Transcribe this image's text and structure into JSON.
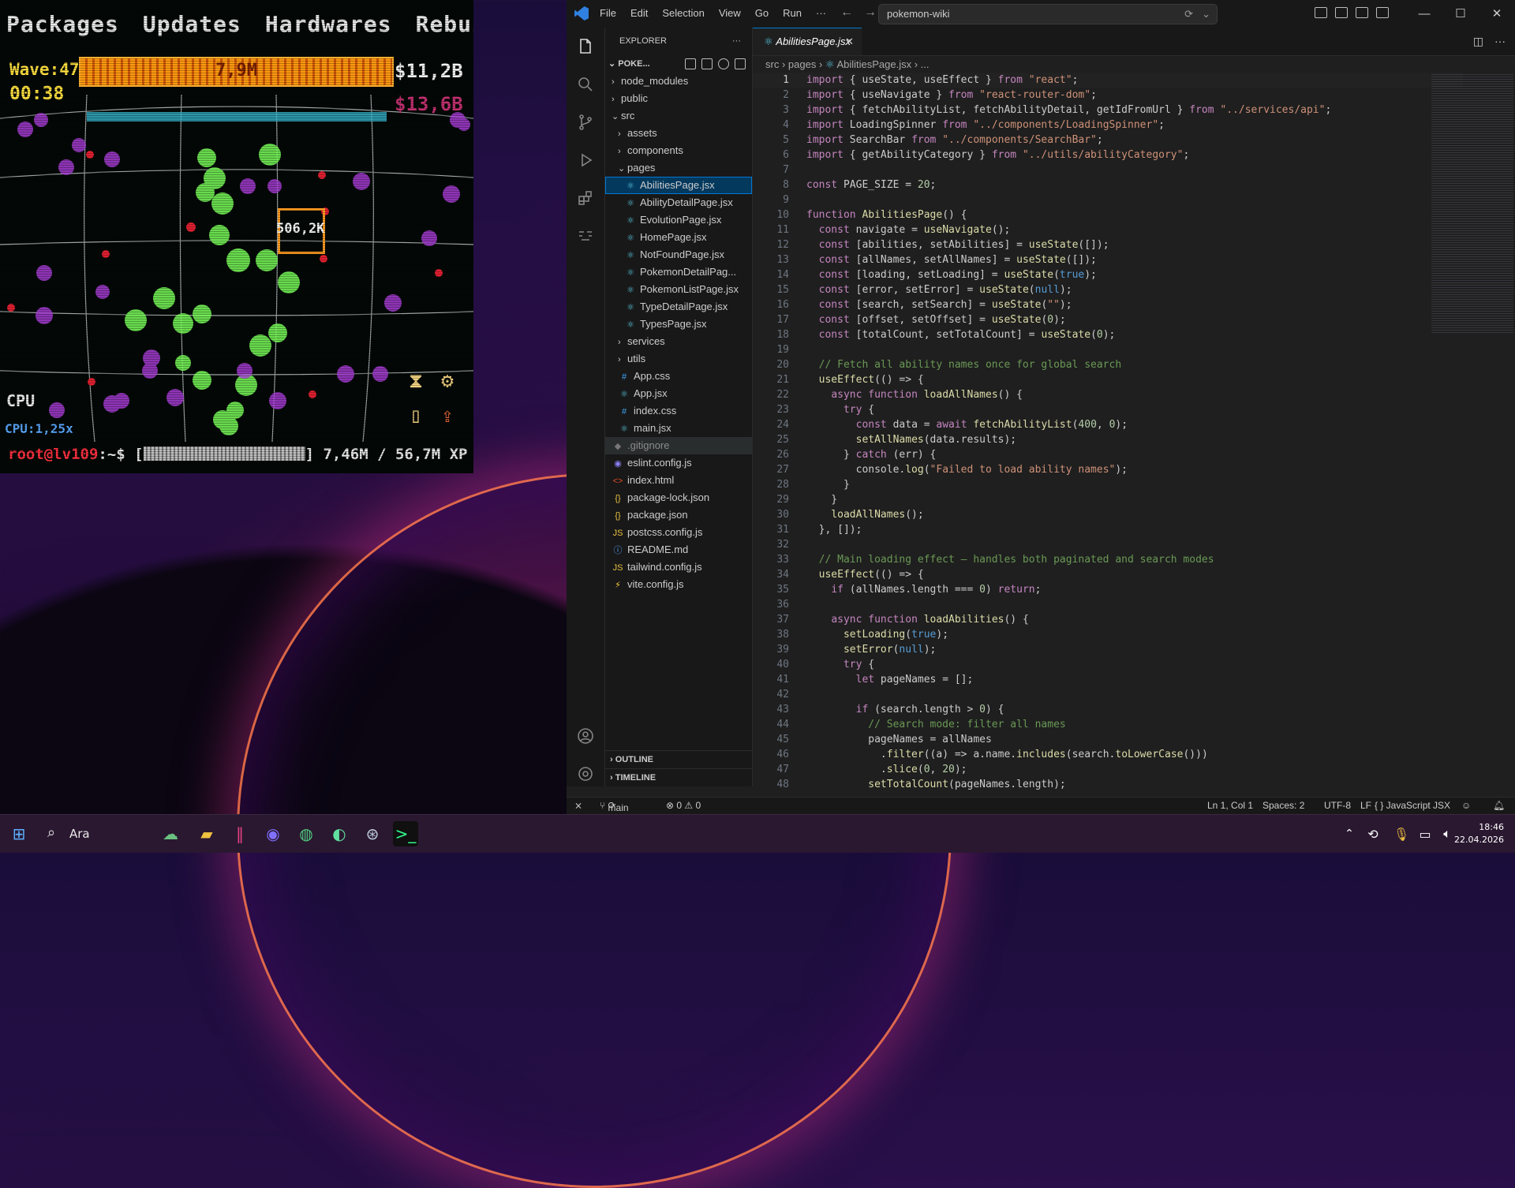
{
  "game": {
    "menu": [
      "Packages",
      "Updates",
      "Hardwares",
      "Rebuild"
    ],
    "wave": "Wave:47",
    "wave_bar_value": "7,9M",
    "timer": "00:38",
    "money_primary": "$11,2B",
    "money_secondary": "$13,6B",
    "target_label": "506,2K",
    "cpu_label": "CPU",
    "cpu_rate": "CPU:1,25x",
    "prompt_user": "root@lv109",
    "prompt_path": ":~$ [",
    "xp_text": "] 7,46M / 56,7M XP"
  },
  "window": {
    "menu": [
      "File",
      "Edit",
      "Selection",
      "View",
      "Go",
      "Run",
      "···"
    ],
    "search_text": "pokemon-wiki",
    "controls": [
      "—",
      "☐",
      "✕"
    ]
  },
  "explorer": {
    "title": "EXPLORER",
    "project": "POKE...",
    "items": [
      {
        "label": "node_modules",
        "indent": 0,
        "type": "folder",
        "open": false
      },
      {
        "label": "public",
        "indent": 0,
        "type": "folder",
        "open": false
      },
      {
        "label": "src",
        "indent": 0,
        "type": "folder",
        "open": true
      },
      {
        "label": "assets",
        "indent": 1,
        "type": "folder",
        "open": false
      },
      {
        "label": "components",
        "indent": 1,
        "type": "folder",
        "open": false
      },
      {
        "label": "pages",
        "indent": 1,
        "type": "folder",
        "open": true
      },
      {
        "label": "AbilitiesPage.jsx",
        "indent": 2,
        "type": "react",
        "selected": true
      },
      {
        "label": "AbilityDetailPage.jsx",
        "indent": 2,
        "type": "react"
      },
      {
        "label": "EvolutionPage.jsx",
        "indent": 2,
        "type": "react"
      },
      {
        "label": "HomePage.jsx",
        "indent": 2,
        "type": "react"
      },
      {
        "label": "NotFoundPage.jsx",
        "indent": 2,
        "type": "react"
      },
      {
        "label": "PokemonDetailPag...",
        "indent": 2,
        "type": "react"
      },
      {
        "label": "PokemonListPage.jsx",
        "indent": 2,
        "type": "react"
      },
      {
        "label": "TypeDetailPage.jsx",
        "indent": 2,
        "type": "react"
      },
      {
        "label": "TypesPage.jsx",
        "indent": 2,
        "type": "react"
      },
      {
        "label": "services",
        "indent": 1,
        "type": "folder",
        "open": false
      },
      {
        "label": "utils",
        "indent": 1,
        "type": "folder",
        "open": false
      },
      {
        "label": "App.css",
        "indent": 1,
        "type": "css"
      },
      {
        "label": "App.jsx",
        "indent": 1,
        "type": "react"
      },
      {
        "label": "index.css",
        "indent": 1,
        "type": "css"
      },
      {
        "label": "main.jsx",
        "indent": 1,
        "type": "react"
      },
      {
        "label": ".gitignore",
        "indent": 0,
        "type": "git",
        "dim": true
      },
      {
        "label": "eslint.config.js",
        "indent": 0,
        "type": "eslint"
      },
      {
        "label": "index.html",
        "indent": 0,
        "type": "html"
      },
      {
        "label": "package-lock.json",
        "indent": 0,
        "type": "json"
      },
      {
        "label": "package.json",
        "indent": 0,
        "type": "json"
      },
      {
        "label": "postcss.config.js",
        "indent": 0,
        "type": "js"
      },
      {
        "label": "README.md",
        "indent": 0,
        "type": "info"
      },
      {
        "label": "tailwind.config.js",
        "indent": 0,
        "type": "js"
      },
      {
        "label": "vite.config.js",
        "indent": 0,
        "type": "vite"
      }
    ],
    "outline": "OUTLINE",
    "timeline": "TIMELINE"
  },
  "editor": {
    "tab": "AbilitiesPage.jsx",
    "breadcrumb": [
      "src",
      "pages",
      "AbilitiesPage.jsx",
      "..."
    ],
    "lines": [
      "import { useState, useEffect } from \"react\";",
      "import { useNavigate } from \"react-router-dom\";",
      "import { fetchAbilityList, fetchAbilityDetail, getIdFromUrl } from \"../services/api\";",
      "import LoadingSpinner from \"../components/LoadingSpinner\";",
      "import SearchBar from \"../components/SearchBar\";",
      "import { getAbilityCategory } from \"../utils/abilityCategory\";",
      "",
      "const PAGE_SIZE = 20;",
      "",
      "function AbilitiesPage() {",
      "  const navigate = useNavigate();",
      "  const [abilities, setAbilities] = useState([]);",
      "  const [allNames, setAllNames] = useState([]);",
      "  const [loading, setLoading] = useState(true);",
      "  const [error, setError] = useState(null);",
      "  const [search, setSearch] = useState(\"\");",
      "  const [offset, setOffset] = useState(0);",
      "  const [totalCount, setTotalCount] = useState(0);",
      "",
      "  // Fetch all ability names once for global search",
      "  useEffect(() => {",
      "    async function loadAllNames() {",
      "      try {",
      "        const data = await fetchAbilityList(400, 0);",
      "        setAllNames(data.results);",
      "      } catch (err) {",
      "        console.log(\"Failed to load ability names\");",
      "      }",
      "    }",
      "    loadAllNames();",
      "  }, []);",
      "",
      "  // Main loading effect — handles both paginated and search modes",
      "  useEffect(() => {",
      "    if (allNames.length === 0) return;",
      "",
      "    async function loadAbilities() {",
      "      setLoading(true);",
      "      setError(null);",
      "      try {",
      "        let pageNames = [];",
      "",
      "        if (search.length > 0) {",
      "          // Search mode: filter all names",
      "          pageNames = allNames",
      "            .filter((a) => a.name.includes(search.toLowerCase()))",
      "            .slice(0, 20);",
      "          setTotalCount(pageNames.length);"
    ]
  },
  "status": {
    "branch": "main",
    "problems": "⊗ 0 ⚠ 0",
    "position": "Ln 1, Col 1",
    "spaces": "Spaces: 2",
    "encoding": "UTF-8",
    "eol": "LF",
    "language": "{ } JavaScript JSX"
  },
  "taskbar": {
    "search_label": "Ara",
    "time": "18:46",
    "date": "22.04.2026"
  }
}
